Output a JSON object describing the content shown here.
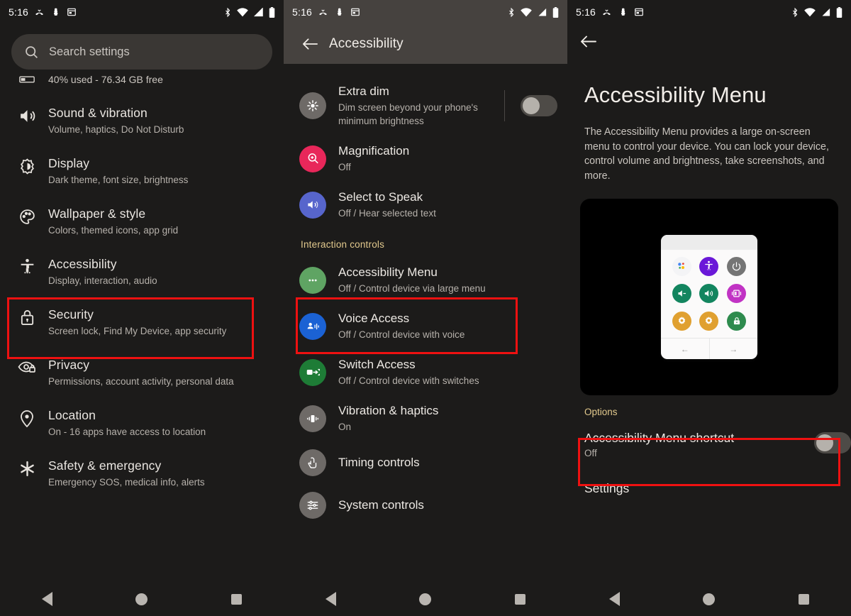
{
  "status_bar": {
    "time": "5:16",
    "left_icons": [
      "missed-call-icon",
      "do-not-disturb-icon",
      "calendar-icon"
    ],
    "right_icons": [
      "bluetooth-icon",
      "wifi-icon",
      "cellular-signal-icon",
      "battery-icon"
    ]
  },
  "panel_left": {
    "search": {
      "placeholder": "Search settings",
      "icon": "search-icon"
    },
    "storage": {
      "icon": "storage-bar-icon",
      "text": "40% used - 76.34 GB free"
    },
    "items": [
      {
        "title": "Sound & vibration",
        "sub": "Volume, haptics, Do Not Disturb",
        "icon": "volume-icon"
      },
      {
        "title": "Display",
        "sub": "Dark theme, font size, brightness",
        "icon": "brightness-icon"
      },
      {
        "title": "Wallpaper & style",
        "sub": "Colors, themed icons, app grid",
        "icon": "palette-icon"
      },
      {
        "title": "Accessibility",
        "sub": "Display, interaction, audio",
        "icon": "accessibility-person-icon"
      },
      {
        "title": "Security",
        "sub": "Screen lock, Find My Device, app security",
        "icon": "lock-icon"
      },
      {
        "title": "Privacy",
        "sub": "Permissions, account activity, personal data",
        "icon": "eye-lock-icon"
      },
      {
        "title": "Location",
        "sub": "On - 16 apps have access to location",
        "icon": "location-pin-icon"
      },
      {
        "title": "Safety & emergency",
        "sub": "Emergency SOS, medical info, alerts",
        "icon": "asterisk-icon"
      }
    ],
    "highlight_index": 3
  },
  "panel_mid": {
    "header": {
      "title": "Accessibility",
      "back_icon": "arrow-back-icon"
    },
    "items": [
      {
        "title": "Extra dim",
        "sub": "Dim screen beyond your phone's minimum brightness",
        "icon": "extra-dim-icon",
        "icon_color": "#6e6a67",
        "toggle": "off"
      },
      {
        "title": "Magnification",
        "sub": "Off",
        "icon": "magnification-icon",
        "icon_color": "#e8275a"
      },
      {
        "title": "Select to Speak",
        "sub": "Off / Hear selected text",
        "icon": "select-to-speak-icon",
        "icon_color": "#5765cc"
      }
    ],
    "section_label": "Interaction controls",
    "items2": [
      {
        "title": "Accessibility Menu",
        "sub": "Off / Control device via large menu",
        "icon": "accessibility-menu-dots-icon",
        "icon_color": "#5fa463"
      },
      {
        "title": "Voice Access",
        "sub": "Off / Control device with voice",
        "icon": "voice-access-icon",
        "icon_color": "#1b62d4"
      },
      {
        "title": "Switch Access",
        "sub": "Off / Control device with switches",
        "icon": "switch-access-icon",
        "icon_color": "#1e7c36"
      },
      {
        "title": "Vibration & haptics",
        "sub": "On",
        "icon": "vibration-icon",
        "icon_color": "#6e6a67"
      },
      {
        "title": "Timing controls",
        "sub": "",
        "icon": "timing-controls-icon",
        "icon_color": "#6e6a67"
      },
      {
        "title": "System controls",
        "sub": "",
        "icon": "system-controls-icon",
        "icon_color": "#6e6a67"
      }
    ],
    "highlight_item": "Accessibility Menu"
  },
  "panel_right": {
    "back_icon": "arrow-back-icon",
    "title": "Accessibility Menu",
    "description": "The Accessibility Menu provides a large on-screen menu to control your device. You can lock your device, control volume and brightness, take screenshots, and more.",
    "preview": {
      "buttons": [
        {
          "name": "assistant-icon",
          "color": "#f4f4f6"
        },
        {
          "name": "accessibility-person-icon",
          "color": "#6a18d8"
        },
        {
          "name": "power-icon",
          "color": "#757575"
        },
        {
          "name": "volume-down-icon",
          "color": "#13855f"
        },
        {
          "name": "volume-up-icon",
          "color": "#13855f"
        },
        {
          "name": "brightness-slider-icon",
          "color": "#c133c4"
        },
        {
          "name": "settings-gear-icon",
          "color": "#e0a030"
        },
        {
          "name": "quick-settings-gear-icon",
          "color": "#e0a030"
        },
        {
          "name": "lock-screen-icon",
          "color": "#2e8b4e"
        }
      ],
      "nav_prev": "←",
      "nav_next": "→"
    },
    "options_label": "Options",
    "shortcut": {
      "title": "Accessibility Menu shortcut",
      "sub": "Off",
      "toggle": "off"
    },
    "settings_label": "Settings"
  },
  "nav_bar": {
    "back": "nav-back-icon",
    "home": "nav-home-icon",
    "recents": "nav-recents-icon"
  },
  "colors": {
    "highlight": "#ee1111",
    "section_label": "#e2c98d",
    "panel_bg": "#1c1b1a",
    "header_bg": "#46423f"
  }
}
